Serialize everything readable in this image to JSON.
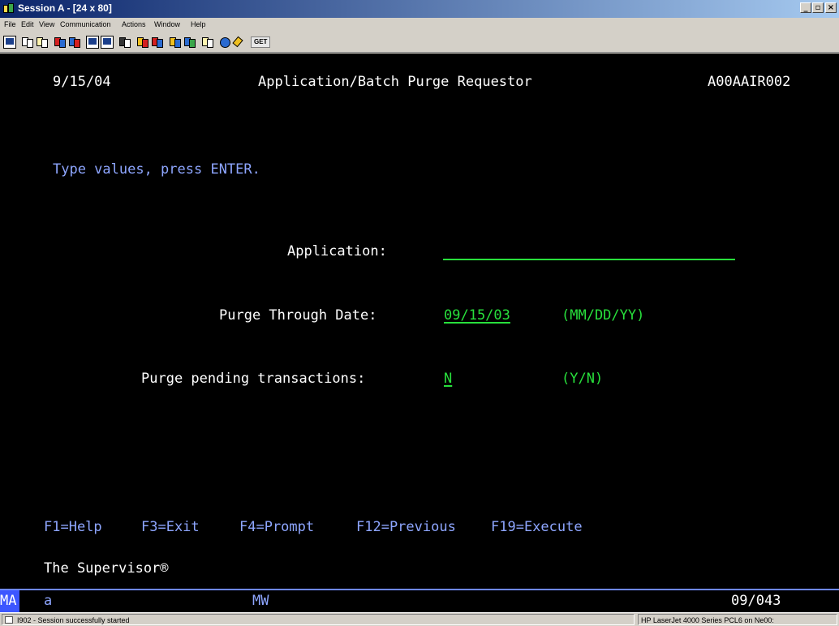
{
  "window": {
    "title": "Session A - [24 x 80]"
  },
  "menu": [
    "File",
    "Edit",
    "View",
    "Communication",
    "Actions",
    "Window",
    "Help"
  ],
  "toolbar": {
    "get_label": "GET"
  },
  "terminal": {
    "date": "9/15/04",
    "title": "Application/Batch Purge Requestor",
    "program_id": "A00AAIR002",
    "instruction": "Type values, press ENTER.",
    "application_label": "Application:",
    "application_value": "",
    "purge_date_label": "Purge Through Date:",
    "purge_date_value": "09/15/03",
    "purge_date_format": "(MM/DD/YY)",
    "pending_label": "Purge pending transactions:",
    "pending_value": "N",
    "pending_format": "(Y/N)",
    "fkeys": [
      "F1=Help",
      "F3=Exit",
      "F4=Prompt",
      "F12=Previous",
      "F19=Execute"
    ],
    "footer": "The Supervisor®"
  },
  "oia": {
    "ma": "MA",
    "indicator": "a",
    "mode": "MW",
    "cursor": "09/043"
  },
  "status": {
    "message": "I902 - Session successfully started",
    "printer": "HP LaserJet 4000 Series PCL6 on Ne00:"
  },
  "colors": {
    "screen_bg": "#000000",
    "field_green": "#28e03c",
    "prompt_blue": "#8ea6ff",
    "titlebar": "#0a246a"
  }
}
